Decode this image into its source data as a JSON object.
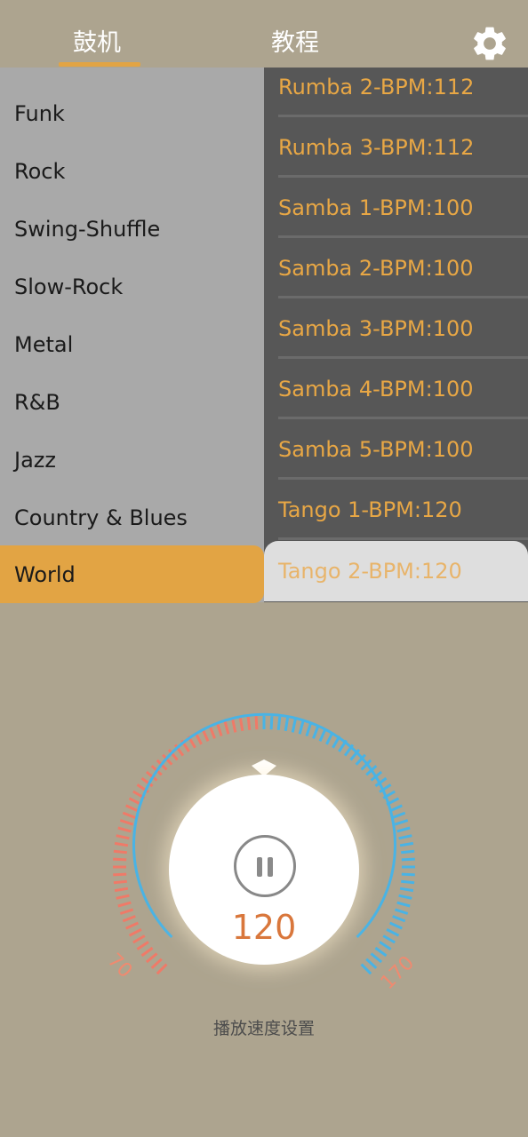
{
  "header": {
    "tabs": [
      "鼓机",
      "教程"
    ],
    "active_tab": "鼓机",
    "settings_icon": "gear-icon",
    "accent_color": "#e2a444"
  },
  "categories": {
    "items": [
      "Funk",
      "Rock",
      "Swing-Shuffle",
      "Slow-Rock",
      "Metal",
      "R&B",
      "Jazz",
      "Country & Blues",
      "World"
    ],
    "selected": "World",
    "selected_color": "#e2a444"
  },
  "rhythms": {
    "items": [
      "Rumba 2-BPM:112",
      "Rumba 3-BPM:112",
      "Samba 1-BPM:100",
      "Samba 2-BPM:100",
      "Samba 3-BPM:100",
      "Samba 4-BPM:100",
      "Samba 5-BPM:100",
      "Tango 1-BPM:120",
      "Tango 2-BPM:120"
    ],
    "selected": "Tango 2-BPM:120",
    "text_color": "#e8a745"
  },
  "tempo": {
    "min_label": "70",
    "max_label": "170",
    "bpm": "120",
    "play_state_icon": "pause-icon",
    "caption": "播放速度设置",
    "low_color": "#ef7a68",
    "high_color": "#49b3e5"
  }
}
